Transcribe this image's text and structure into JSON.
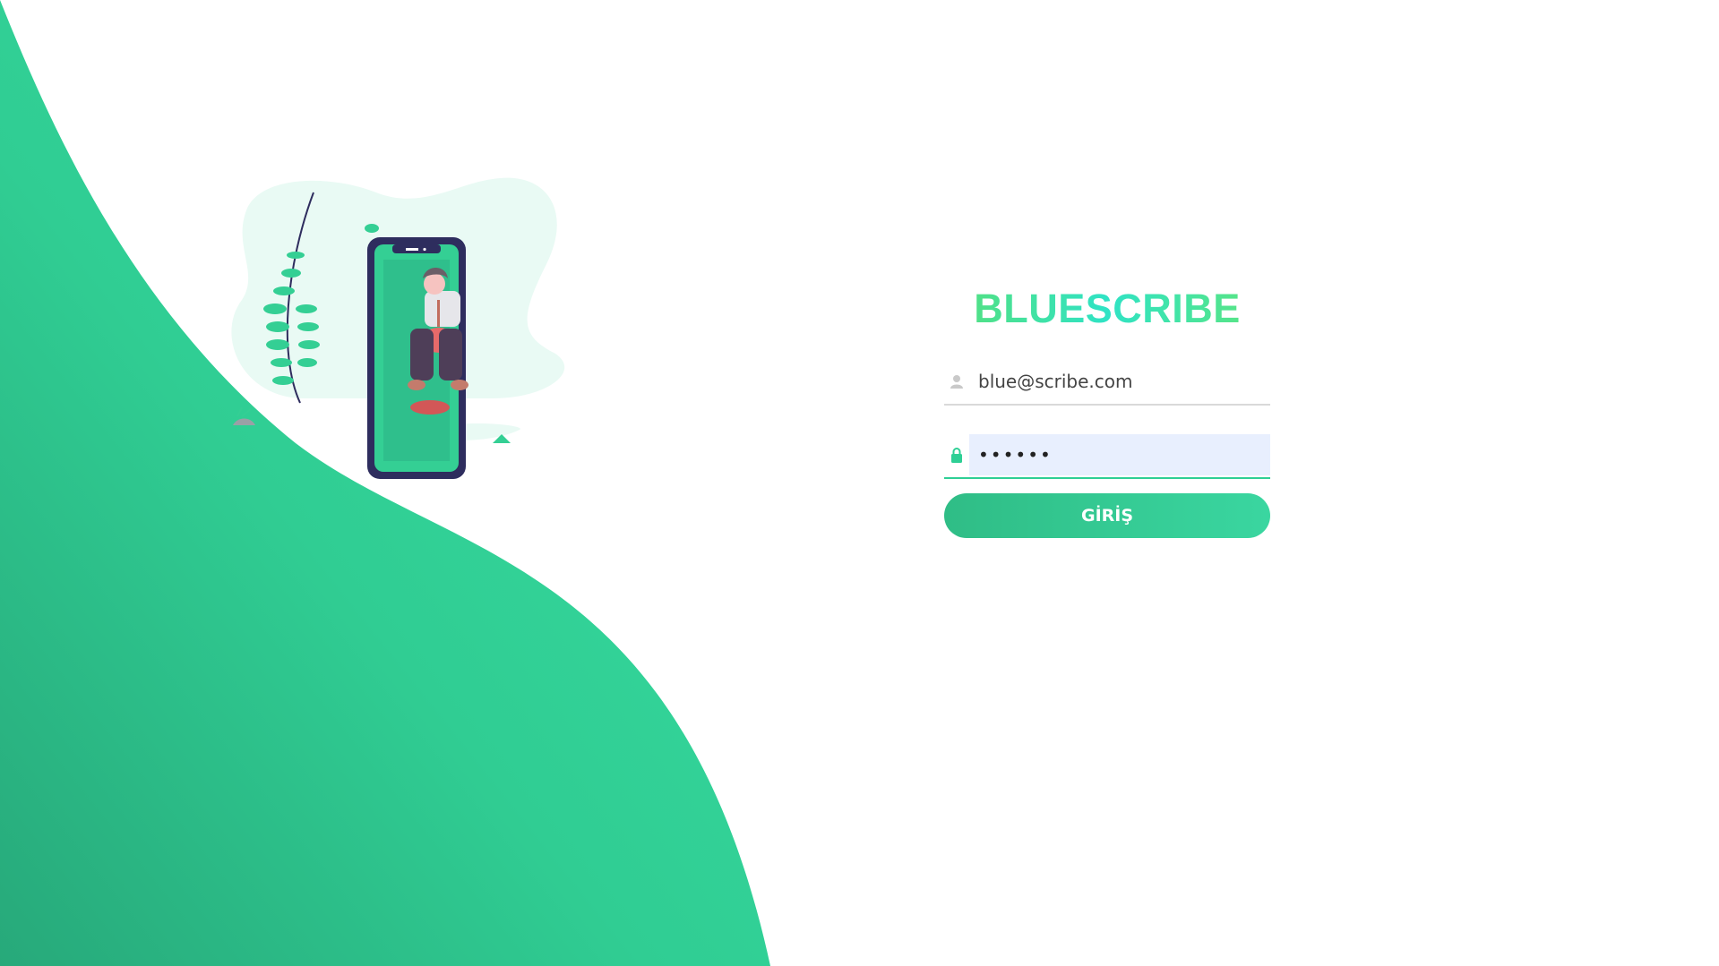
{
  "brand": {
    "title": "BLUESCRIBE"
  },
  "form": {
    "email": {
      "value": "blue@scribe.com",
      "icon": "user-icon"
    },
    "password": {
      "value": "••••••",
      "icon": "lock-icon"
    },
    "submit_label": "GİRİŞ"
  },
  "colors": {
    "accent": "#2ecf95",
    "wave_dark": "#27a97a",
    "wave_light": "#33d69b",
    "brand_green": "#57e07a",
    "brand_cyan": "#2fe3c5"
  }
}
